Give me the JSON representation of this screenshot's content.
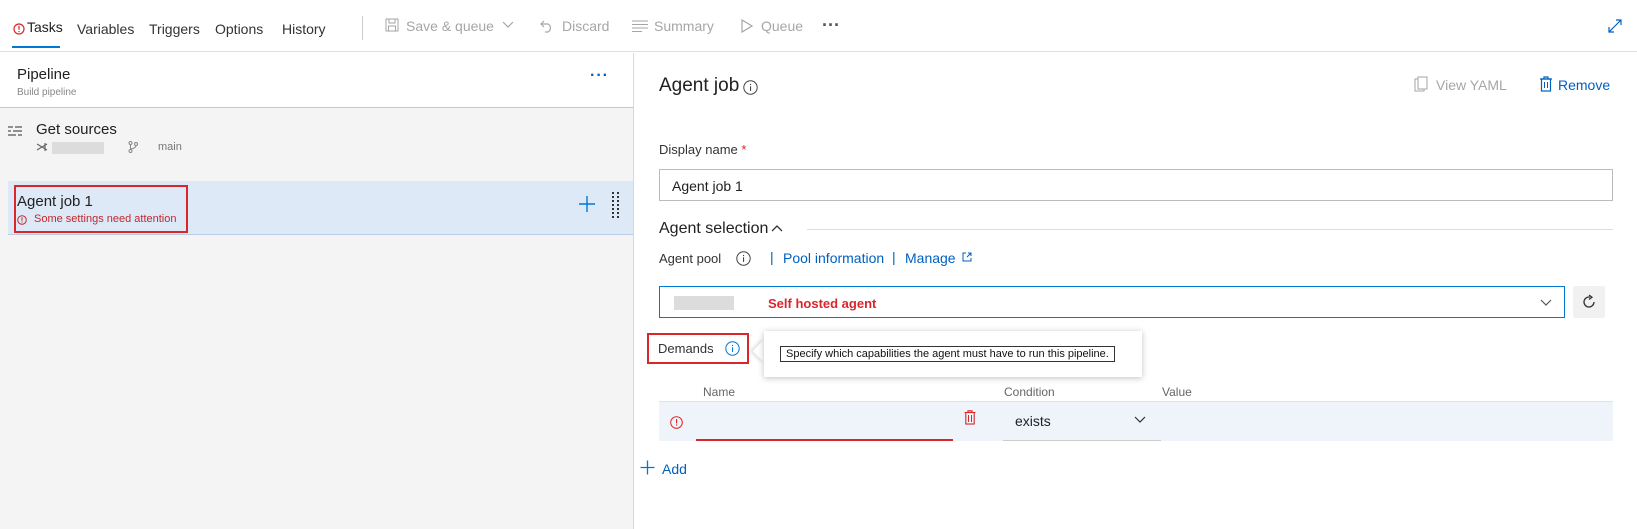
{
  "topbar": {
    "tabs": [
      {
        "label": "Tasks",
        "active": true
      },
      {
        "label": "Variables"
      },
      {
        "label": "Triggers"
      },
      {
        "label": "Options"
      },
      {
        "label": "History"
      }
    ],
    "actions": {
      "save_queue": "Save & queue",
      "discard": "Discard",
      "summary": "Summary",
      "queue": "Queue",
      "more": "···"
    }
  },
  "pipeline": {
    "title": "Pipeline",
    "subtitle": "Build pipeline",
    "more": "···",
    "get_sources": {
      "title": "Get sources",
      "branch": "main"
    },
    "job": {
      "title": "Agent job 1",
      "warning": "Some settings need attention"
    }
  },
  "detail": {
    "title": "Agent job",
    "view_yaml": "View YAML",
    "remove": "Remove",
    "display_name_label": "Display name",
    "required_mark": "*",
    "display_name_value": "Agent job 1",
    "agent_selection": "Agent selection",
    "agent_pool_label": "Agent pool",
    "pool_information": "Pool information",
    "manage": "Manage",
    "separator": "|",
    "pool_value": "Self hosted agent",
    "demands_label": "Demands",
    "tooltip": "Specify which capabilities the agent must have to run this pipeline.",
    "columns": {
      "name": "Name",
      "condition": "Condition",
      "value": "Value"
    },
    "condition_value": "exists",
    "add": "Add"
  },
  "colors": {
    "accent": "#0078d4",
    "link": "#0060c0",
    "error": "#d9262b",
    "selected_row": "#dde9f6"
  }
}
